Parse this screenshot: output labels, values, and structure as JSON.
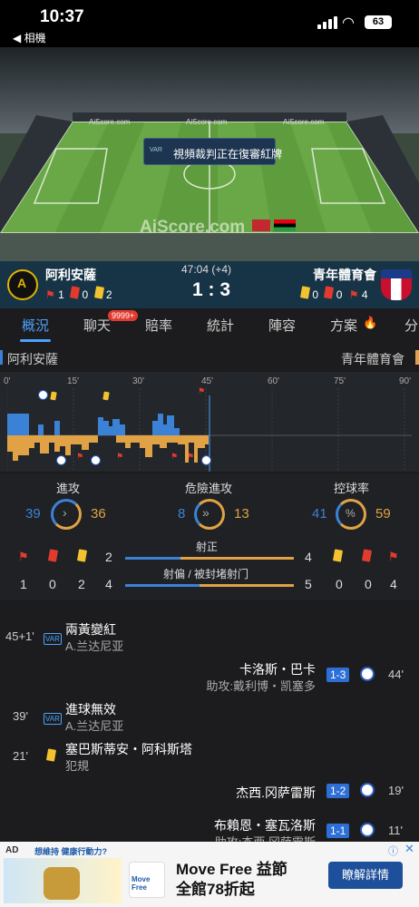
{
  "status_bar": {
    "time": "10:37",
    "back_label": "◀ 相機",
    "battery": "63"
  },
  "field": {
    "banner": "視頻裁判正在復審紅牌",
    "watermark": "AiScore.com",
    "board_text": "AiScore.com"
  },
  "match": {
    "home": "阿利安薩",
    "away": "青年體育會",
    "clock": "47:04 (+4)",
    "score": "1 : 3",
    "home_counts": {
      "corners": "1",
      "red": "0",
      "yellow": "2"
    },
    "away_counts": {
      "yellow": "0",
      "red": "0",
      "corners": "4"
    }
  },
  "tabs": [
    "概況",
    "聊天",
    "賠率",
    "統計",
    "陣容",
    "方案",
    "分"
  ],
  "chat_badge": "9999+",
  "timeline": {
    "ticks": [
      "0'",
      "15'",
      "30'",
      "45'",
      "60'",
      "75'",
      "90'"
    ]
  },
  "stats": {
    "attack": {
      "label": "進攻",
      "home": "39",
      "away": "36"
    },
    "danger": {
      "label": "危險進攻",
      "home": "8",
      "away": "13"
    },
    "possession": {
      "label": "控球率",
      "home": "41",
      "away": "59",
      "symbol": "%"
    },
    "on_target": {
      "label": "射正",
      "home": "2",
      "away": "4"
    },
    "off_target": {
      "label": "射偏 / 被封堵射门",
      "home": "4",
      "away": "5"
    },
    "home_row2": [
      "1",
      "0",
      "2"
    ],
    "away_row2": [
      "0",
      "0",
      "4"
    ]
  },
  "events": [
    {
      "side": "home",
      "minute": "45+1'",
      "title": "兩黃變紅",
      "sub": "A.兰达尼亚",
      "icon": "var"
    },
    {
      "side": "away",
      "minute": "44'",
      "title": "卡洛斯・巴卡",
      "sub": "助攻:戴利博・凯塞多",
      "score": "1-3",
      "icon": "goal"
    },
    {
      "side": "home",
      "minute": "39'",
      "title": "進球無效",
      "sub": "A.兰达尼亚",
      "icon": "var"
    },
    {
      "side": "home",
      "minute": "21'",
      "title": "塞巴斯蒂安・阿科斯塔",
      "sub": "犯規",
      "icon": "yellow"
    },
    {
      "side": "away",
      "minute": "19'",
      "title": "杰西.冈萨雷斯",
      "sub": "",
      "score": "1-2",
      "icon": "goal"
    },
    {
      "side": "away",
      "minute": "11'",
      "title": "布賴恩・塞瓦洛斯",
      "sub": "助攻:杰西.冈萨雷斯",
      "score": "1-1",
      "icon": "goal"
    }
  ],
  "ad": {
    "badge": "AD",
    "headline": "Move Free 益節",
    "subline": "全館78折起",
    "cta": "瞭解詳情",
    "left_text": "想維持 健康行動力?",
    "brand": "Move Free"
  },
  "colors": {
    "home_bar": "#3b82d6",
    "away_bar": "#e0a244",
    "accent": "#4aa3ff"
  }
}
